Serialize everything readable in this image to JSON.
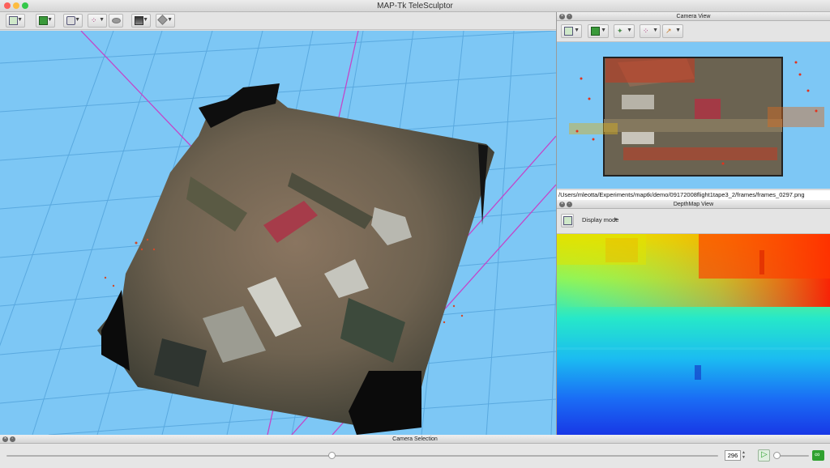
{
  "window": {
    "title": "MAP-Tk TeleSculptor"
  },
  "main_toolbar": {
    "buttons": [
      {
        "name": "camera-reset-view-button",
        "icon": "frame-view-icon"
      },
      {
        "name": "image-layer-button",
        "icon": "image-icon"
      },
      {
        "name": "camera-frustum-button",
        "icon": "camera-icon"
      },
      {
        "name": "landmarks-button",
        "icon": "point-cloud-icon"
      },
      {
        "name": "ground-plane-button",
        "icon": "plane-icon"
      },
      {
        "name": "depth-image-button",
        "icon": "depth-icon"
      },
      {
        "name": "volume-surface-button",
        "icon": "mesh-icon"
      }
    ]
  },
  "camera_view": {
    "title": "Camera View",
    "image_path": "/Users/mleotta/Experiments/maptk/demo/09172008flight1tape3_2/frames/frames_0297.png"
  },
  "depthmap_view": {
    "title": "DepthMap View",
    "display_mode_label": "Display mode"
  },
  "camera_selection": {
    "title": "Camera Selection",
    "frame_value": "296",
    "slider_fraction": 0.457,
    "speed_fraction": 0.05
  },
  "colors": {
    "view_background": "#7dc7f5",
    "grid_line": "#5aa9df",
    "frustum_line": "#c247c9",
    "play_accent": "#2fa12f"
  }
}
